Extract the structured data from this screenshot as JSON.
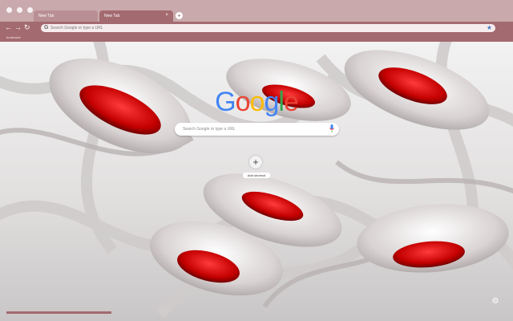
{
  "browser": {
    "tabs": [
      {
        "label": "New Tab",
        "active": false
      },
      {
        "label": "New Tab",
        "active": true
      }
    ],
    "tab_close": "×",
    "new_tab": "+",
    "nav": {
      "back": "←",
      "forward": "→",
      "reload": "↻",
      "home": "⌂"
    },
    "omnibox": {
      "placeholder": "Search Google or type a URL"
    },
    "bookmark_star": "★",
    "bookmarks_bar_label": "bookmark",
    "accent_color": "#a36a6f",
    "tabstrip_color": "#c9a9ac"
  },
  "main": {
    "logo_letters": [
      "G",
      "o",
      "o",
      "g",
      "l",
      "e"
    ],
    "logo_colors": [
      "#4285F4",
      "#EA4335",
      "#FBBC05",
      "#4285F4",
      "#34A853",
      "#EA4335"
    ],
    "search_placeholder": "Search Google or type a URL",
    "add_shortcut_label": "Add shortcut",
    "add_shortcut_icon": "+"
  },
  "footer": {
    "status_text": "",
    "progress_fraction": 1.0,
    "customize_icon": "gear-icon"
  }
}
